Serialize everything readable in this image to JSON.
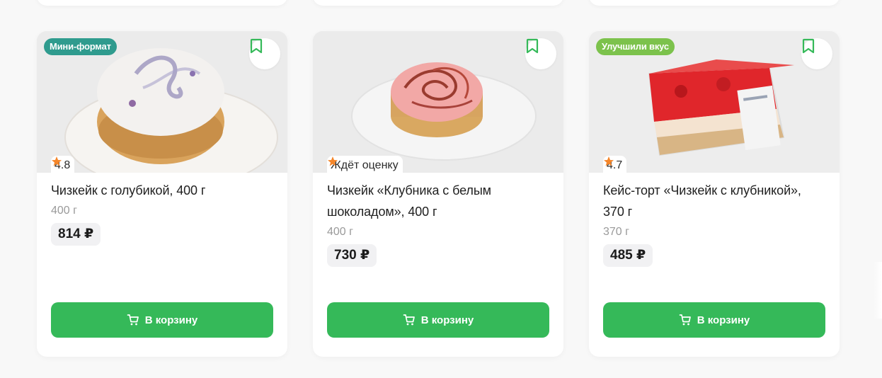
{
  "colors": {
    "accent_green": "#35b959",
    "badge_teal": "#2f9b8e",
    "badge_lightgreen": "#7cc24c",
    "star_orange": "#f5862a"
  },
  "products": [
    {
      "badge": "Мини-формат",
      "rating_text": "4.8",
      "title": "Чизкейк с голубикой, 400 г",
      "weight": "400 г",
      "price": "814 ₽",
      "cart_label": "В корзину",
      "icons": [
        "star-icon",
        "bookmark-icon",
        "cart-icon"
      ]
    },
    {
      "badge": "",
      "rating_text": "Ждёт оценку",
      "title": "Чизкейк «Клубника с белым шоколадом», 400 г",
      "weight": "400 г",
      "price": "730 ₽",
      "cart_label": "В корзину",
      "icons": [
        "star-icon",
        "bookmark-icon",
        "cart-icon"
      ]
    },
    {
      "badge": "Улучшили вкус",
      "rating_text": "4.7",
      "title": "Кейс-торт «Чизкейк с клубникой», 370 г",
      "weight": "370 г",
      "price": "485 ₽",
      "cart_label": "В корзину",
      "icons": [
        "star-icon",
        "bookmark-icon",
        "cart-icon"
      ]
    }
  ]
}
